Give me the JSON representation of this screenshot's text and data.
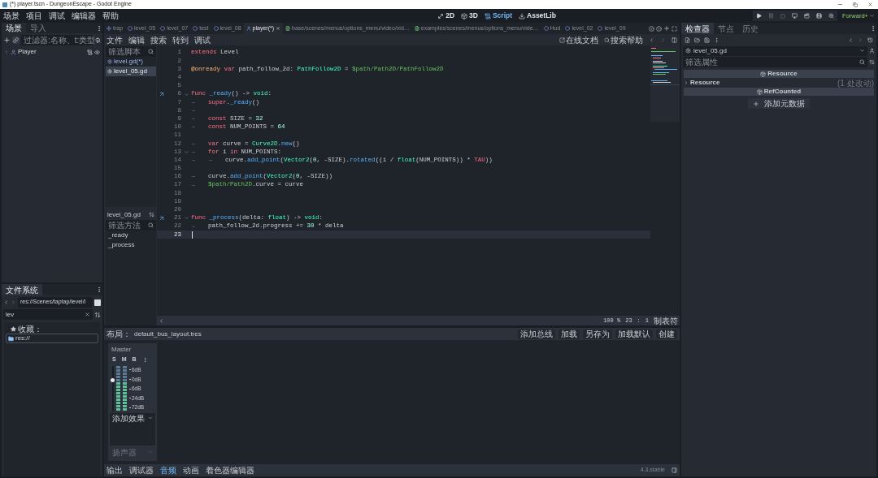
{
  "window": {
    "title": "(*) player.tscn - DungeonEscape - Godot Engine"
  },
  "menu": [
    "场景",
    "项目",
    "调试",
    "编辑器",
    "帮助"
  ],
  "workspaces": [
    {
      "label": "2D",
      "kind": "plane",
      "selected": false
    },
    {
      "label": "3D",
      "kind": "space",
      "selected": false
    },
    {
      "label": "Script",
      "kind": "script",
      "selected": true
    },
    {
      "label": "AssetLib",
      "kind": "assetlib",
      "selected": false
    }
  ],
  "renderer": "Forward+",
  "scene_dock": {
    "tabs": [
      {
        "label": "场景",
        "selected": true
      },
      {
        "label": "导入",
        "selected": false
      }
    ],
    "filter": {
      "placeholder": "过滤器:名称、t:类型"
    },
    "tree": [
      {
        "label": "Player"
      }
    ]
  },
  "filesystem": {
    "tabs": [
      {
        "label": "文件系统",
        "selected": true
      }
    ],
    "path": "res://Scenes/taptap/level/l",
    "search": "lev",
    "favorites": "收藏：",
    "tree": [
      {
        "label": "res://"
      }
    ]
  },
  "script_tabs": [
    {
      "label": "trap",
      "kind": "move",
      "selected": false
    },
    {
      "label": "level_05",
      "kind": "node",
      "selected": false
    },
    {
      "label": "level_07",
      "kind": "node",
      "selected": false
    },
    {
      "label": "test",
      "kind": "node",
      "selected": false
    },
    {
      "label": "level_08",
      "kind": "node",
      "selected": false
    },
    {
      "label": "player(*)",
      "kind": "person",
      "selected": true
    },
    {
      "label": "base/scenes/menus/options_menu/video/vid…",
      "kind": "file",
      "selected": false
    },
    {
      "label": "examples/scenes/menus/options_menu/vide…",
      "kind": "file",
      "selected": false
    },
    {
      "label": "Hud",
      "kind": "node",
      "selected": false
    },
    {
      "label": "level_02",
      "kind": "node",
      "selected": false
    },
    {
      "label": "level_09",
      "kind": "node",
      "selected": false
    }
  ],
  "script_menu": [
    "文件",
    "编辑",
    "搜索",
    "转到",
    "调试"
  ],
  "help_buttons": [
    "在线文档",
    "搜索帮助"
  ],
  "script_list": {
    "filter": {
      "placeholder": "筛选脚本"
    },
    "items": [
      {
        "label": "level.gd(*)",
        "selected": false
      },
      {
        "label": "level_05.gd",
        "selected": true
      }
    ]
  },
  "method_list": {
    "title": "level_05.gd",
    "filter": {
      "placeholder": "筛选方法"
    },
    "items": [
      "_ready",
      "_process"
    ]
  },
  "code": {
    "lines": [
      {
        "number": "1",
        "foldable": false,
        "override": false,
        "current": false,
        "tokens": [
          {
            "kind": "keyword",
            "text": "extends"
          },
          {
            "kind": "plain",
            "text": " Level"
          }
        ]
      },
      {
        "number": "2",
        "foldable": false,
        "override": false,
        "current": false
      },
      {
        "number": "3",
        "foldable": false,
        "override": false,
        "current": false,
        "tokens": [
          {
            "kind": "annotation",
            "text": "@onready"
          },
          {
            "kind": "keyword",
            "text": " var"
          },
          {
            "kind": "plain",
            "text": " path_follow_2d: "
          },
          {
            "kind": "type",
            "text": "PathFollow2D"
          },
          {
            "kind": "plain",
            "text": " = "
          },
          {
            "kind": "path",
            "text": "$path/Path2D/PathFollow2D"
          }
        ]
      },
      {
        "number": "4",
        "foldable": false,
        "override": false,
        "current": false
      },
      {
        "number": "5",
        "foldable": false,
        "override": false,
        "current": false
      },
      {
        "number": "6",
        "foldable": true,
        "override": true,
        "current": false,
        "tokens": [
          {
            "kind": "keyword",
            "text": "func"
          },
          {
            "kind": "function",
            "text": " _ready"
          },
          {
            "kind": "plain",
            "text": "() -> "
          },
          {
            "kind": "type",
            "text": "void"
          },
          {
            "kind": "plain",
            "text": ":"
          }
        ]
      },
      {
        "number": "7",
        "foldable": false,
        "override": false,
        "current": false,
        "tabs": [
          {
            "kind": "tab"
          }
        ],
        "tokens": [
          {
            "kind": "keyword",
            "text": "super"
          },
          {
            "kind": "plain",
            "text": "."
          },
          {
            "kind": "function",
            "text": "_ready"
          },
          {
            "kind": "plain",
            "text": "()"
          }
        ]
      },
      {
        "number": "8",
        "foldable": false,
        "override": false,
        "current": false,
        "tabs": [
          {
            "kind": "tab"
          }
        ]
      },
      {
        "number": "9",
        "foldable": false,
        "override": false,
        "current": false,
        "tabs": [
          {
            "kind": "tab"
          }
        ],
        "tokens": [
          {
            "kind": "keyword",
            "text": "const"
          },
          {
            "kind": "plain",
            "text": " SIZE = "
          },
          {
            "kind": "number",
            "text": "32"
          }
        ]
      },
      {
        "number": "10",
        "foldable": false,
        "override": false,
        "current": false,
        "tabs": [
          {
            "kind": "tab"
          }
        ],
        "tokens": [
          {
            "kind": "keyword",
            "text": "const"
          },
          {
            "kind": "plain",
            "text": " NUM_POINTS = "
          },
          {
            "kind": "number",
            "text": "64"
          }
        ]
      },
      {
        "number": "11",
        "foldable": false,
        "override": false,
        "current": false
      },
      {
        "number": "12",
        "foldable": false,
        "override": false,
        "current": false,
        "tabs": [
          {
            "kind": "tab"
          }
        ],
        "tokens": [
          {
            "kind": "keyword",
            "text": "var"
          },
          {
            "kind": "plain",
            "text": " curve = "
          },
          {
            "kind": "type",
            "text": "Curve2D"
          },
          {
            "kind": "plain",
            "text": "."
          },
          {
            "kind": "function",
            "text": "new"
          },
          {
            "kind": "plain",
            "text": "()"
          }
        ]
      },
      {
        "number": "13",
        "foldable": true,
        "override": false,
        "current": false,
        "tabs": [
          {
            "kind": "tab"
          }
        ],
        "tokens": [
          {
            "kind": "keyword",
            "text": "for"
          },
          {
            "kind": "plain",
            "text": " i "
          },
          {
            "kind": "keyword",
            "text": "in"
          },
          {
            "kind": "plain",
            "text": " NUM_POINTS:"
          }
        ]
      },
      {
        "number": "14",
        "foldable": false,
        "override": false,
        "current": false,
        "tabs": [
          {
            "kind": "tab"
          },
          {
            "kind": "tab"
          }
        ],
        "tokens": [
          {
            "kind": "plain",
            "text": "curve."
          },
          {
            "kind": "function",
            "text": "add_point"
          },
          {
            "kind": "plain",
            "text": "("
          },
          {
            "kind": "type",
            "text": "Vector2"
          },
          {
            "kind": "plain",
            "text": "("
          },
          {
            "kind": "number",
            "text": "0"
          },
          {
            "kind": "plain",
            "text": ", -SIZE)."
          },
          {
            "kind": "function",
            "text": "rotated"
          },
          {
            "kind": "plain",
            "text": "((i / "
          },
          {
            "kind": "type",
            "text": "float"
          },
          {
            "kind": "plain",
            "text": "(NUM_POINTS)) * "
          },
          {
            "kind": "keyword",
            "text": "TAU"
          },
          {
            "kind": "plain",
            "text": "))"
          }
        ]
      },
      {
        "number": "15",
        "foldable": false,
        "override": false,
        "current": false
      },
      {
        "number": "16",
        "foldable": false,
        "override": false,
        "current": false,
        "tabs": [
          {
            "kind": "tab"
          }
        ],
        "tokens": [
          {
            "kind": "plain",
            "text": "curve."
          },
          {
            "kind": "function",
            "text": "add_point"
          },
          {
            "kind": "plain",
            "text": "("
          },
          {
            "kind": "type",
            "text": "Vector2"
          },
          {
            "kind": "plain",
            "text": "("
          },
          {
            "kind": "number",
            "text": "0"
          },
          {
            "kind": "plain",
            "text": ", -SIZE))"
          }
        ]
      },
      {
        "number": "17",
        "foldable": false,
        "override": false,
        "current": false,
        "tabs": [
          {
            "kind": "tab"
          }
        ],
        "tokens": [
          {
            "kind": "path",
            "text": "$path/Path2D"
          },
          {
            "kind": "plain",
            "text": ".curve = curve"
          }
        ]
      },
      {
        "number": "18",
        "foldable": false,
        "override": false,
        "current": false
      },
      {
        "number": "19",
        "foldable": false,
        "override": false,
        "current": false
      },
      {
        "number": "20",
        "foldable": false,
        "override": false,
        "current": false
      },
      {
        "number": "21",
        "foldable": true,
        "override": true,
        "current": false,
        "tokens": [
          {
            "kind": "keyword",
            "text": "func"
          },
          {
            "kind": "function",
            "text": " _process"
          },
          {
            "kind": "plain",
            "text": "(delta: "
          },
          {
            "kind": "type",
            "text": "float"
          },
          {
            "kind": "plain",
            "text": ") -> "
          },
          {
            "kind": "type",
            "text": "void"
          },
          {
            "kind": "plain",
            "text": ":"
          }
        ]
      },
      {
        "number": "22",
        "foldable": false,
        "override": false,
        "current": false,
        "tabs": [
          {
            "kind": "tab"
          }
        ],
        "tokens": [
          {
            "kind": "plain",
            "text": "path_follow_2d.progress += "
          },
          {
            "kind": "number",
            "text": "30"
          },
          {
            "kind": "plain",
            "text": " * delta"
          }
        ]
      },
      {
        "number": "23",
        "foldable": false,
        "override": false,
        "current": true
      }
    ]
  },
  "status": {
    "zoom": "100 %",
    "line": "23",
    "separator": ":",
    "column": "1",
    "indent": "制表符"
  },
  "audio": {
    "layout_label": "布局：",
    "layout_file": "default_bus_layout.tres",
    "buttons": [
      "添加总线",
      "加载",
      "另存为",
      "加载默认",
      "创建"
    ],
    "buses": [
      {
        "name": "Master",
        "toggles": [
          "S",
          "M",
          "B"
        ],
        "level": 0.7,
        "scale": [
          "6dB",
          "0dB",
          "6dB",
          "24dB",
          "72dB"
        ],
        "effect": "添加效果",
        "output": "扬声器"
      }
    ]
  },
  "bottom_tabs": [
    {
      "label": "输出",
      "selected": false
    },
    {
      "label": "调试器",
      "selected": false
    },
    {
      "label": "音频",
      "selected": true
    },
    {
      "label": "动画",
      "selected": false
    },
    {
      "label": "着色器编辑器",
      "selected": false
    }
  ],
  "version": "4.3.stable",
  "inspector": {
    "tabs": [
      {
        "label": "检查器",
        "selected": true
      },
      {
        "label": "节点",
        "selected": false
      },
      {
        "label": "历史",
        "selected": false
      }
    ],
    "resource": "level_05.gd",
    "filter": {
      "placeholder": "筛选属性"
    },
    "sections": [
      {
        "kind": "header",
        "label": "Resource"
      },
      {
        "kind": "group",
        "label": "Resource",
        "note": "(1 处改动)"
      },
      {
        "kind": "header",
        "label": "RefCounted"
      }
    ],
    "add_button": "添加元数据"
  }
}
